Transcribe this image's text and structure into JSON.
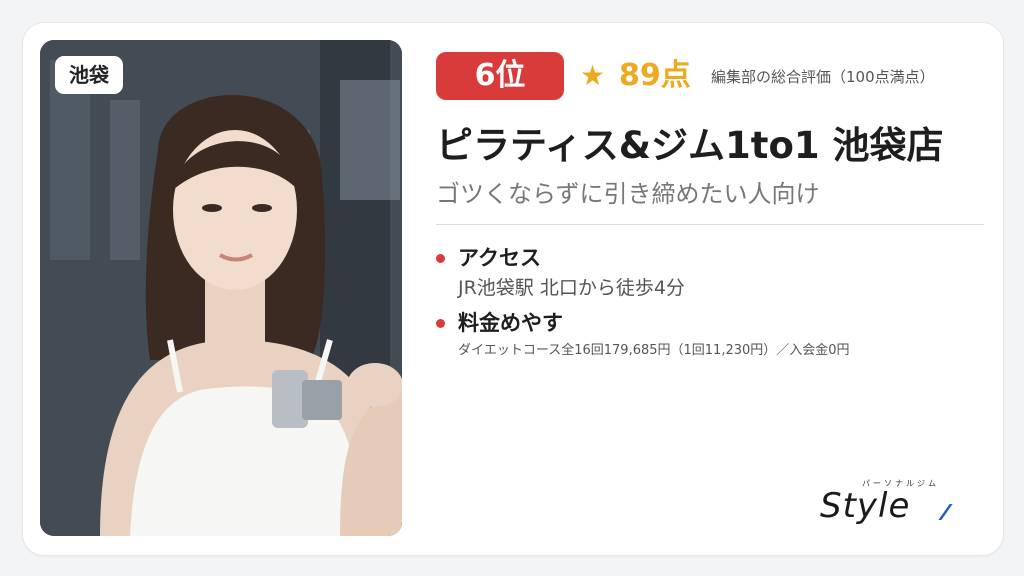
{
  "area_tag": "池袋",
  "rank": "6位",
  "star_icon": "★",
  "score": "89点",
  "score_note": "編集部の総合評価（100点満点）",
  "gym_name": "ピラティス&ジム1to1 池袋店",
  "tagline": "ゴツくならずに引き締めたい人向け",
  "access": {
    "label": "アクセス",
    "value": "JR池袋駅 北口から徒歩4分"
  },
  "price": {
    "label": "料金めやす",
    "value": "ダイエットコース全16回179,685円（1回11,230円）／入会金0円"
  },
  "logo": {
    "kana": "パーソナルジム",
    "word": "Style"
  },
  "colors": {
    "accent_red": "#d93a3a",
    "star_gold": "#eda91f"
  }
}
